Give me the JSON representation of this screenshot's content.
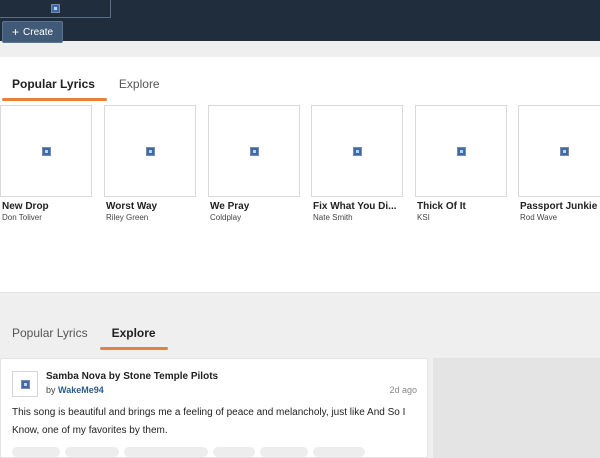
{
  "header": {
    "create_label": "Create"
  },
  "popular": {
    "tabs": [
      {
        "label": "Popular Lyrics",
        "active": true
      },
      {
        "label": "Explore",
        "active": false
      }
    ],
    "cards": [
      {
        "title": "New Drop",
        "artist": "Don Toliver"
      },
      {
        "title": "Worst Way",
        "artist": "Riley Green"
      },
      {
        "title": "We Pray",
        "artist": "Coldplay"
      },
      {
        "title": "Fix What You Di...",
        "artist": "Nate Smith"
      },
      {
        "title": "Thick Of It",
        "artist": "KSI"
      },
      {
        "title": "Passport Junkie",
        "artist": "Rod Wave"
      }
    ]
  },
  "explore": {
    "tabs": [
      {
        "label": "Popular Lyrics",
        "active": false
      },
      {
        "label": "Explore",
        "active": true
      }
    ],
    "post": {
      "title": "Samba Nova by Stone Temple Pilots",
      "by_prefix": "by",
      "user": "WakeMe94",
      "time": "2d ago",
      "body": "This song is beautiful and brings me a feeling of peace and melancholy, just like And So I Know, one of my favorites by them."
    }
  },
  "colors": {
    "header_bg": "#1f2d3d",
    "accent": "#e8803b",
    "link": "#2a5d8f"
  },
  "icons": {
    "create": "plus-icon",
    "placeholder": "broken-image-icon"
  }
}
